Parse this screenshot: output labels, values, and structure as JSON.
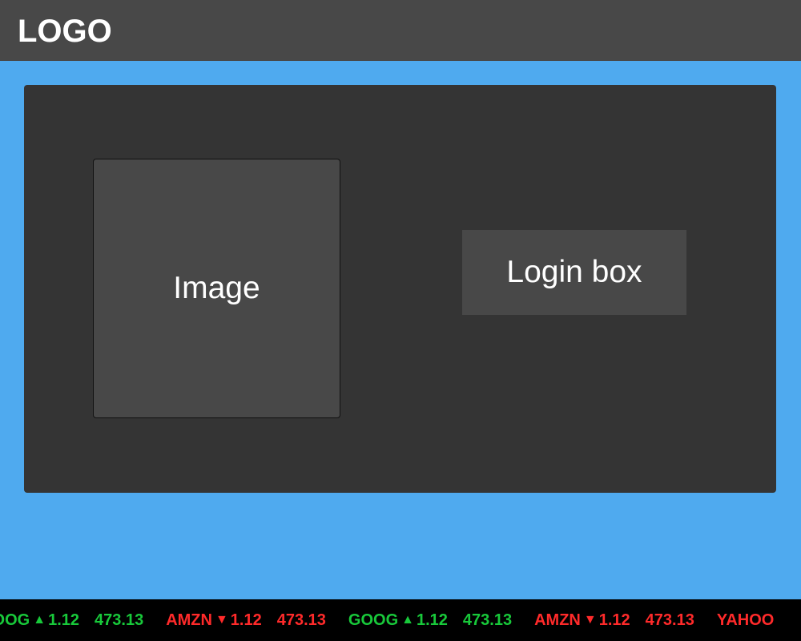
{
  "header": {
    "logo_text": "LOGO"
  },
  "main": {
    "image_label": "Image",
    "login_label": "Login box"
  },
  "ticker": {
    "items": [
      {
        "symbol": "GOOG",
        "direction": "up",
        "arrow": "▲",
        "change": "1.12",
        "price": "473.13"
      },
      {
        "symbol": "AMZN",
        "direction": "down",
        "arrow": "▼",
        "change": "1.12",
        "price": "473.13"
      },
      {
        "symbol": "GOOG",
        "direction": "up",
        "arrow": "▲",
        "change": "1.12",
        "price": "473.13"
      },
      {
        "symbol": "AMZN",
        "direction": "down",
        "arrow": "▼",
        "change": "1.12",
        "price": "473.13"
      },
      {
        "symbol": "YAHOO",
        "direction": "down",
        "arrow": "",
        "change": "",
        "price": ""
      }
    ],
    "colors": {
      "up": "#18c93a",
      "down": "#ff2a2a"
    }
  }
}
